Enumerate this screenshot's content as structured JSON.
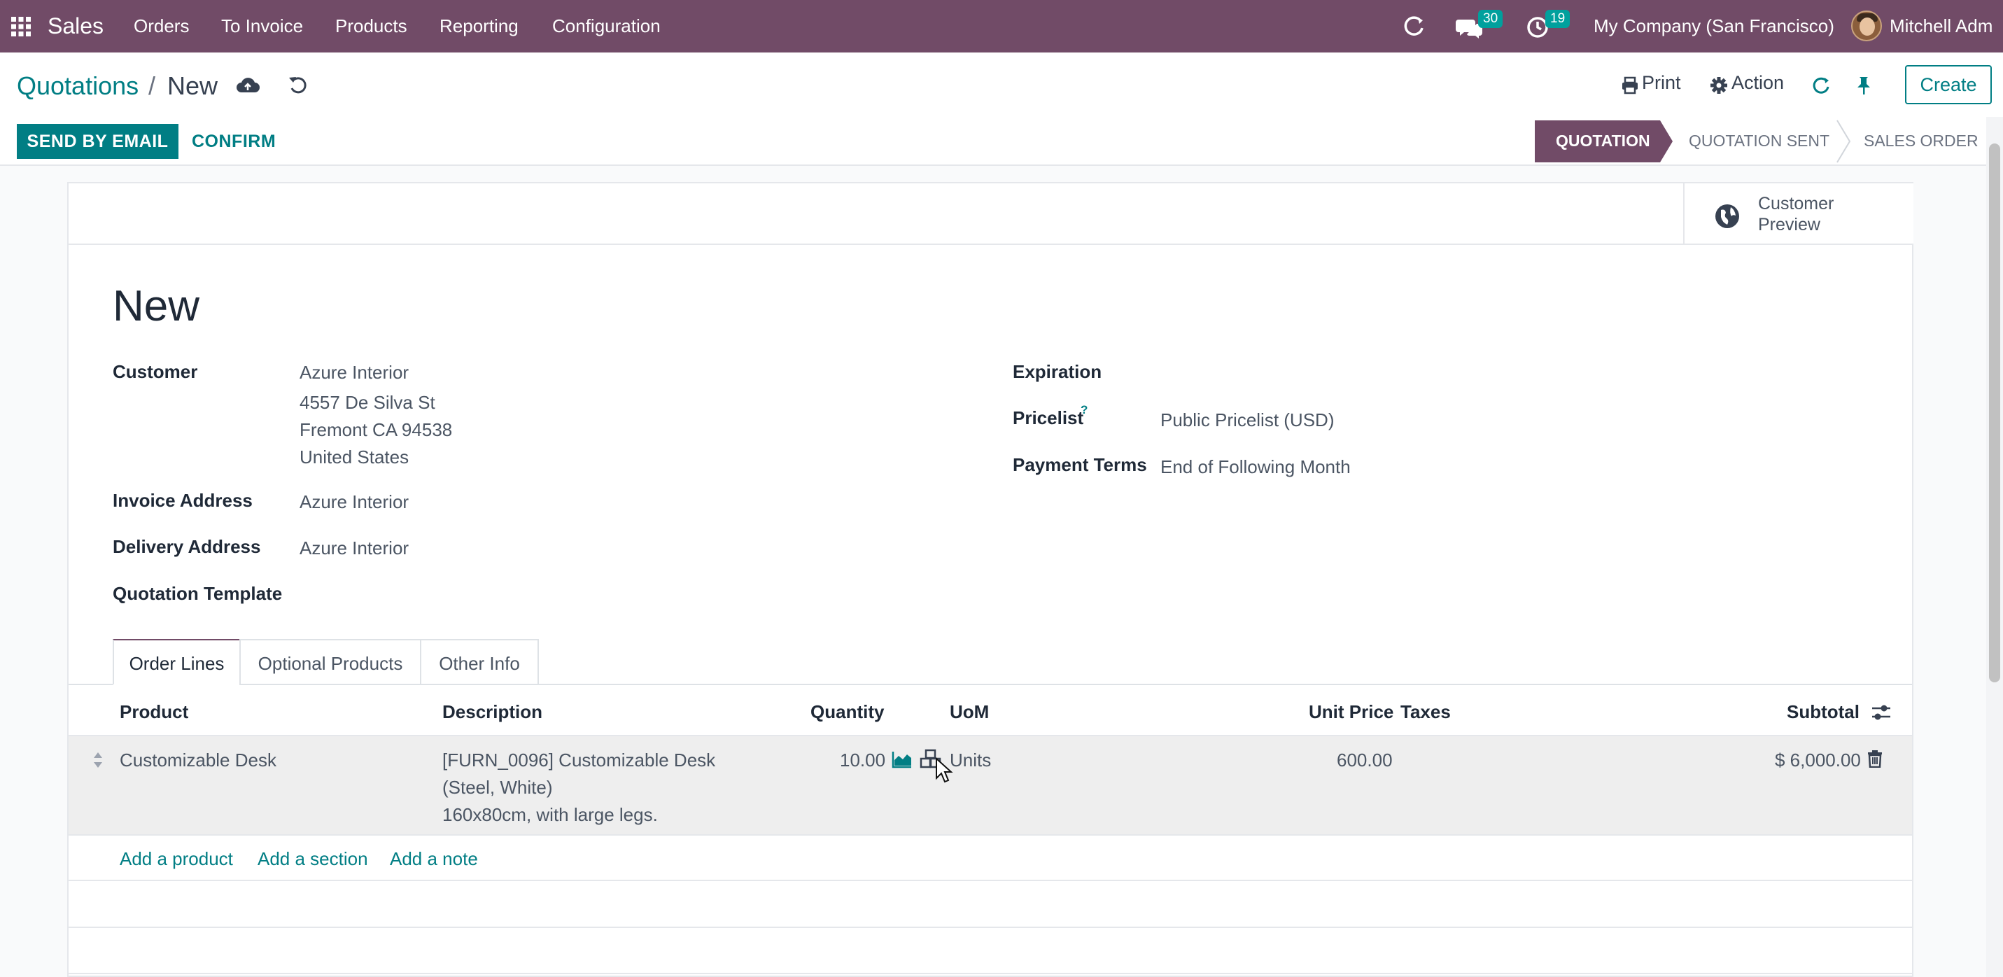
{
  "navbar": {
    "app_name": "Sales",
    "menu": [
      "Orders",
      "To Invoice",
      "Products",
      "Reporting",
      "Configuration"
    ],
    "messages_count": "30",
    "activities_count": "19",
    "company": "My Company (San Francisco)",
    "user": "Mitchell Adm"
  },
  "breadcrumb": {
    "parent": "Quotations",
    "separator": "/",
    "current": "New"
  },
  "control_panel": {
    "print_label": "Print",
    "action_label": "Action",
    "create_label": "Create"
  },
  "statusbar": {
    "send_label": "SEND BY EMAIL",
    "confirm_label": "CONFIRM",
    "stages": [
      "QUOTATION",
      "QUOTATION SENT",
      "SALES ORDER"
    ],
    "active_stage": "QUOTATION"
  },
  "smart_button": {
    "line1": "Customer",
    "line2": "Preview"
  },
  "form": {
    "title": "New",
    "customer_label": "Customer",
    "customer_name": "Azure Interior",
    "customer_address": [
      "4557 De Silva St",
      "Fremont CA 94538",
      "United States"
    ],
    "invoice_address_label": "Invoice Address",
    "invoice_address": "Azure Interior",
    "delivery_address_label": "Delivery Address",
    "delivery_address": "Azure Interior",
    "template_label": "Quotation Template",
    "expiration_label": "Expiration",
    "pricelist_label": "Pricelist",
    "pricelist_help": "?",
    "pricelist": "Public Pricelist (USD)",
    "payment_terms_label": "Payment Terms",
    "payment_terms": "End of Following Month"
  },
  "tabs": [
    "Order Lines",
    "Optional Products",
    "Other Info"
  ],
  "order_lines": {
    "columns": [
      "Product",
      "Description",
      "Quantity",
      "UoM",
      "Unit Price",
      "Taxes",
      "Subtotal"
    ],
    "rows": [
      {
        "product": "Customizable Desk",
        "description": [
          "[FURN_0096] Customizable Desk",
          "(Steel, White)",
          "160x80cm, with large legs."
        ],
        "quantity": "10.00",
        "uom": "Units",
        "unit_price": "600.00",
        "taxes": "",
        "subtotal": "$ 6,000.00"
      }
    ],
    "add_product": "Add a product",
    "add_section": "Add a section",
    "add_note": "Add a note"
  },
  "colors": {
    "navbar": "#714b67",
    "primary": "#017e84",
    "stage_active": "#714b67"
  }
}
